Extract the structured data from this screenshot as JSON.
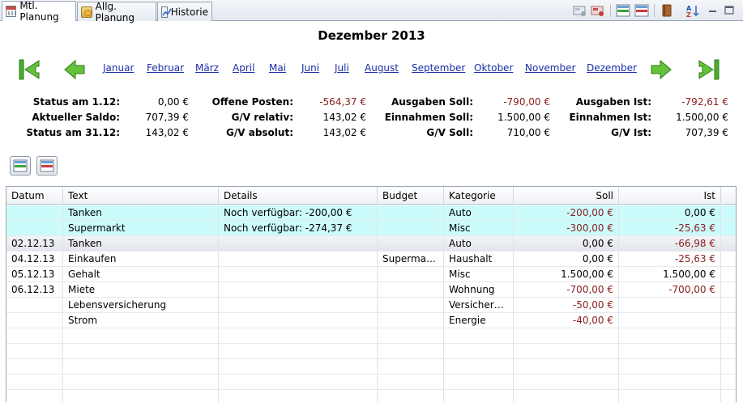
{
  "tabs": [
    {
      "label": "Mtl. Planung",
      "active": true,
      "icon": "calendar-icon"
    },
    {
      "label": "Allg. Planung",
      "active": false,
      "icon": "budget-planning-icon"
    },
    {
      "label": "Historie",
      "active": false,
      "icon": "history-chart-icon"
    }
  ],
  "toolbar": {
    "icons": [
      "import-icon",
      "export-icon",
      "add-row-icon",
      "remove-row-icon",
      "book-icon",
      "sort-az-icon",
      "minimize-icon",
      "maximize-icon"
    ]
  },
  "header": {
    "title": "Dezember 2013",
    "months": [
      "Januar",
      "Februar",
      "März",
      "April",
      "Mai",
      "Juni",
      "Juli",
      "August",
      "September",
      "Oktober",
      "November",
      "Dezember"
    ]
  },
  "summary": {
    "col1": [
      {
        "label": "Status am 1.12:",
        "value": "0,00 €"
      },
      {
        "label": "Aktueller Saldo:",
        "value": "707,39 €"
      },
      {
        "label": "Status am 31.12:",
        "value": "143,02 €"
      }
    ],
    "col2": [
      {
        "label": "Offene Posten:",
        "value": "-564,37 €"
      },
      {
        "label": "G/V relativ:",
        "value": "143,02 €"
      },
      {
        "label": "G/V absolut:",
        "value": "143,02 €"
      }
    ],
    "col3": [
      {
        "label": "Ausgaben Soll:",
        "value": "-790,00 €"
      },
      {
        "label": "Einnahmen Soll:",
        "value": "1.500,00 €"
      },
      {
        "label": "G/V Soll:",
        "value": "710,00 €"
      }
    ],
    "col4": [
      {
        "label": "Ausgaben Ist:",
        "value": "-792,61 €"
      },
      {
        "label": "Einnahmen Ist:",
        "value": "1.500,00 €"
      },
      {
        "label": "G/V Ist:",
        "value": "707,39 €"
      }
    ]
  },
  "table": {
    "columns": [
      "Datum",
      "Text",
      "Details",
      "Budget",
      "Kategorie",
      "Soll",
      "Ist"
    ],
    "rows": [
      {
        "datum": "",
        "text": "Tanken",
        "details": "Noch verfügbar: -200,00 €",
        "budget": "",
        "kategorie": "Auto",
        "soll": "-200,00 €",
        "ist": "0,00 €"
      },
      {
        "datum": "",
        "text": "Supermarkt",
        "details": "Noch verfügbar: -274,37 €",
        "budget": "",
        "kategorie": "Misc",
        "soll": "-300,00 €",
        "ist": "-25,63 €"
      },
      {
        "datum": "02.12.13",
        "text": "Tanken",
        "details": "",
        "budget": "",
        "kategorie": "Auto",
        "soll": "0,00 €",
        "ist": "-66,98 €"
      },
      {
        "datum": "04.12.13",
        "text": "Einkaufen",
        "details": "",
        "budget": "Supermarkt",
        "kategorie": "Haushalt",
        "soll": "0,00 €",
        "ist": "-25,63 €"
      },
      {
        "datum": "05.12.13",
        "text": "Gehalt",
        "details": "",
        "budget": "",
        "kategorie": "Misc",
        "soll": "1.500,00 €",
        "ist": "1.500,00 €"
      },
      {
        "datum": "06.12.13",
        "text": "Miete",
        "details": "",
        "budget": "",
        "kategorie": "Wohnung",
        "soll": "-700,00 €",
        "ist": "-700,00 €"
      },
      {
        "datum": "",
        "text": "Lebensversicherung",
        "details": "",
        "budget": "",
        "kategorie": "Versicherun...",
        "soll": "-50,00 €",
        "ist": ""
      },
      {
        "datum": "",
        "text": "Strom",
        "details": "",
        "budget": "",
        "kategorie": "Energie",
        "soll": "-40,00 €",
        "ist": ""
      }
    ]
  },
  "colors": {
    "budget_row": "#ccfbfb",
    "negative": "#8b1c1c",
    "link": "#1a2fa8",
    "nav_arrow": "#4fae2c"
  }
}
